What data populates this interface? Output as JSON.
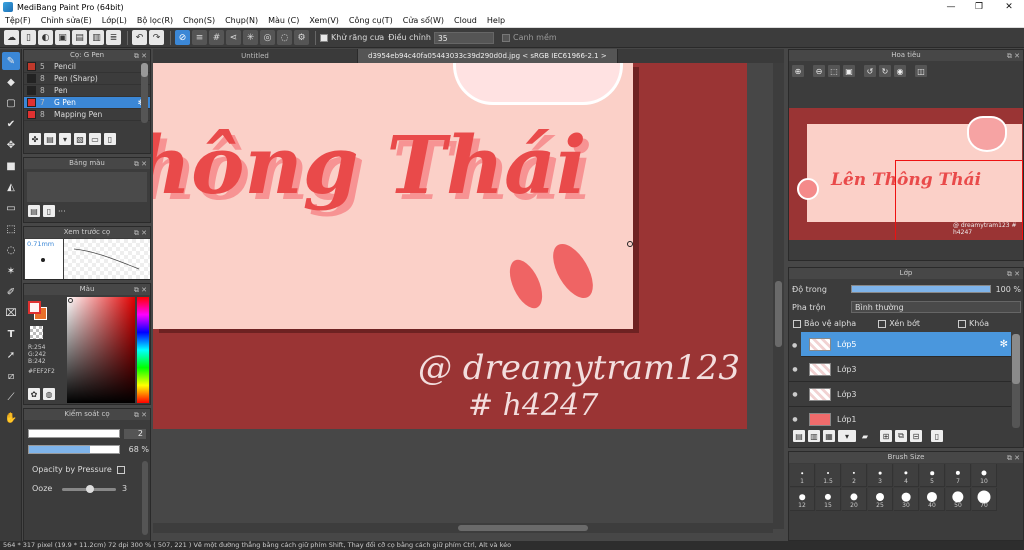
{
  "window": {
    "title": "MediBang Paint Pro (64bit)",
    "min_glyph": "—",
    "max_glyph": "❐",
    "close_glyph": "✕"
  },
  "menu": [
    "Tệp(F)",
    "Chỉnh sửa(E)",
    "Lớp(L)",
    "Bộ lọc(R)",
    "Chọn(S)",
    "Chụp(N)",
    "Màu (C)",
    "Xem(V)",
    "Công cụ(T)",
    "Cửa sổ(W)",
    "Cloud",
    "Help"
  ],
  "toolbar": {
    "antialias_label": "Khử răng cưa",
    "adjust_label": "Điều chỉnh",
    "adjust_value": "35",
    "soften_label": "Canh mềm"
  },
  "document": {
    "tabs": [
      "Untitled",
      "d3954eb94c40fa05443033c39d290d0d.jpg < sRGB IEC61966-2.1 >"
    ]
  },
  "brush_panel": {
    "title": "Cọ: G Pen",
    "items": [
      {
        "size": "5",
        "name": "Pencil",
        "color": "#c0392b"
      },
      {
        "size": "8",
        "name": "Pen (Sharp)",
        "color": "#222222"
      },
      {
        "size": "8",
        "name": "Pen",
        "color": "#222222"
      },
      {
        "size": "7",
        "name": "G Pen",
        "color": "#e03131"
      },
      {
        "size": "8",
        "name": "Mapping Pen",
        "color": "#e03131"
      }
    ]
  },
  "palette_panel": {
    "title": "Bảng màu",
    "more": "···"
  },
  "preview_panel": {
    "title": "Xem trước cọ",
    "size_label": "0.71mm"
  },
  "color_panel": {
    "title": "Màu",
    "r": "R:254",
    "g": "G:242",
    "b": "B:242",
    "hex": "#FEF2F2",
    "fg": "#fef2f2",
    "bg": "#e7702a"
  },
  "brush_control": {
    "title": "Kiểm soát cọ",
    "size_value": "2",
    "opacity_value": "68 %",
    "opacity_fraction": 0.68,
    "pressure_label": "Opacity by Pressure",
    "ooze_label": "Ooze",
    "ooze_value": "3",
    "ooze_fraction": 0.45
  },
  "navigator": {
    "title": "Hoa tiêu",
    "art_text": "Lên Thông Thái",
    "signature": "@ dreamytram123  # h4247"
  },
  "canvas": {
    "title_text": "hông Thái",
    "signature_line1": "@ dreamytram123",
    "signature_line2": "# h4247"
  },
  "layer_panel": {
    "title": "Lớp",
    "opacity_label": "Độ trong",
    "opacity_value": "100 %",
    "opacity_fraction": 1.0,
    "blend_label": "Pha trộn",
    "blend_value": "Bình thường",
    "protect_alpha": "Bảo vệ alpha",
    "clipping": "Xén bớt",
    "lock": "Khóa",
    "layers": [
      {
        "name": "Lớp5",
        "selected": true
      },
      {
        "name": "Lớp3",
        "selected": false
      },
      {
        "name": "Lớp3",
        "selected": false
      },
      {
        "name": "Lớp1",
        "selected": false
      }
    ]
  },
  "brush_size_panel": {
    "title": "Brush Size",
    "row1": [
      "1",
      "1.5",
      "2",
      "3",
      "4",
      "5",
      "7",
      "10"
    ],
    "row2": [
      "12",
      "15",
      "20",
      "25",
      "30",
      "40",
      "50",
      "70"
    ]
  },
  "status": "564 * 317 pixel   (19.9 * 11.2cm)   72 dpi   300 %   ( 507, 221 )   Vẽ một đường thẳng bằng cách giữ phím Shift, Thay đổi cỡ cọ bằng cách giữ phím Ctrl, Alt và kéo"
}
